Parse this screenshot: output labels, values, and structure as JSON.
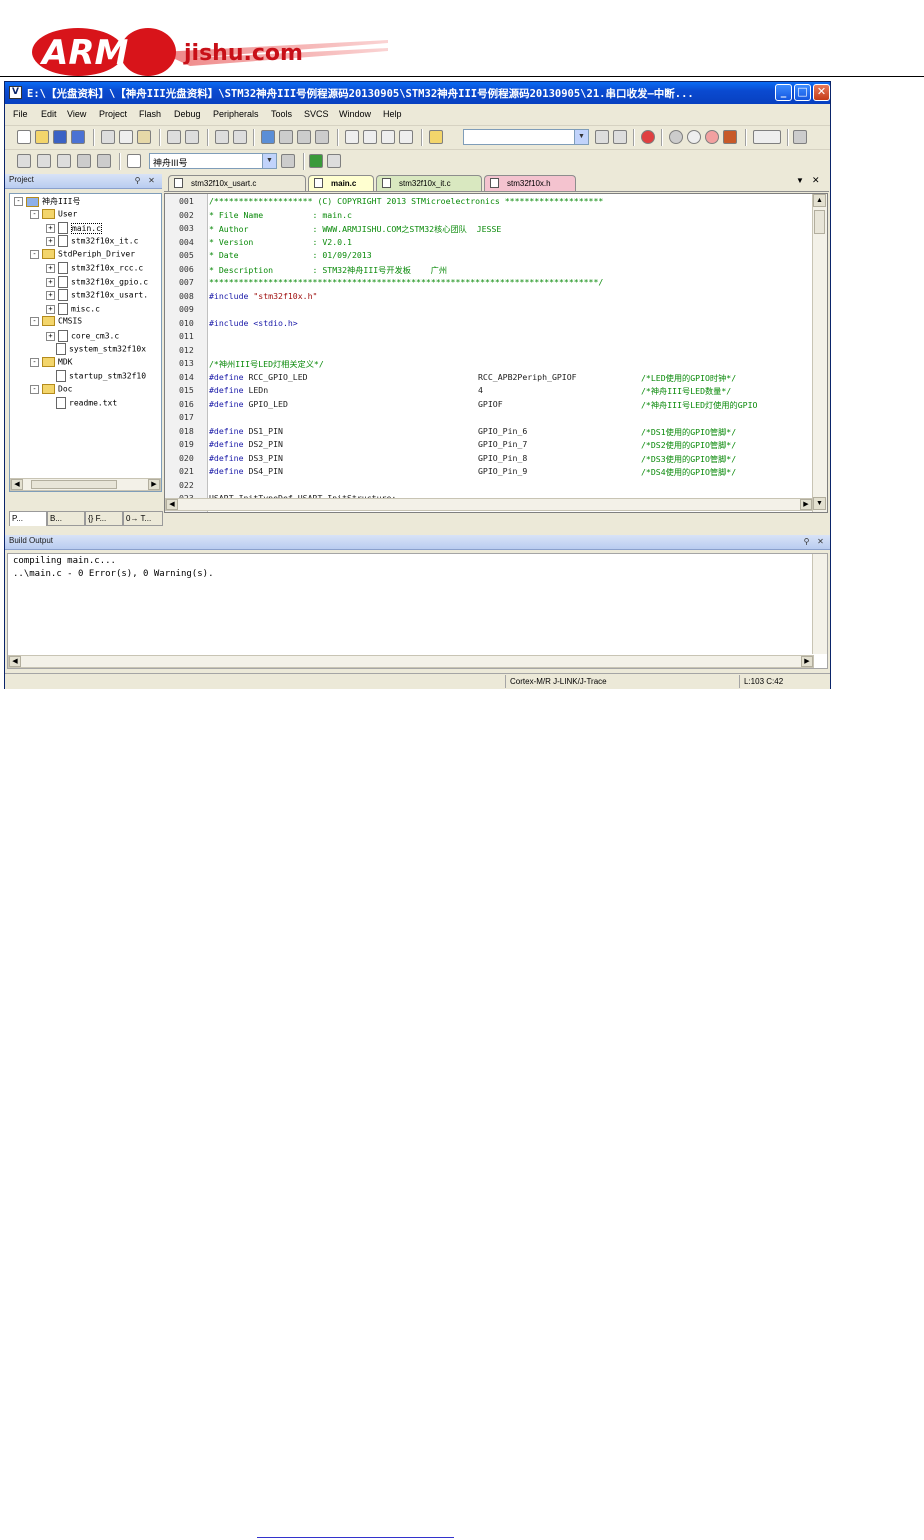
{
  "logo": {
    "text_arm": "ARM",
    "text_domain": "jishu.com"
  },
  "window": {
    "title": "E:\\【光盘资料】\\【神舟III光盘资料】\\STM32神舟III号例程源码20130905\\STM32神舟III号例程源码20130905\\21.串口收发—中断...",
    "buttons": {
      "minimize": "_",
      "maximize": "□",
      "close": "✕"
    }
  },
  "menu": [
    "File",
    "Edit",
    "View",
    "Project",
    "Flash",
    "Debug",
    "Peripherals",
    "Tools",
    "SVCS",
    "Window",
    "Help"
  ],
  "toolbar2": {
    "target_select": "神舟III号"
  },
  "project_panel": {
    "title": "Project",
    "tree": [
      {
        "label": "神舟III号",
        "type": "root",
        "expander": "-"
      },
      {
        "label": "User",
        "type": "folder",
        "expander": "-"
      },
      {
        "label": "main.c",
        "type": "file",
        "expander": "+",
        "selected": true
      },
      {
        "label": "stm32f10x_it.c",
        "type": "file",
        "expander": "+"
      },
      {
        "label": "StdPeriph_Driver",
        "type": "folder",
        "expander": "-"
      },
      {
        "label": "stm32f10x_rcc.c",
        "type": "file",
        "expander": "+"
      },
      {
        "label": "stm32f10x_gpio.c",
        "type": "file",
        "expander": "+"
      },
      {
        "label": "stm32f10x_usart.",
        "type": "file",
        "expander": "+"
      },
      {
        "label": "misc.c",
        "type": "file",
        "expander": "+"
      },
      {
        "label": "CMSIS",
        "type": "folder",
        "expander": "-"
      },
      {
        "label": "core_cm3.c",
        "type": "file",
        "expander": "+"
      },
      {
        "label": "system_stm32f10x",
        "type": "file",
        "expander": ""
      },
      {
        "label": "MDK",
        "type": "folder",
        "expander": "-"
      },
      {
        "label": "startup_stm32f10",
        "type": "file",
        "expander": ""
      },
      {
        "label": "Doc",
        "type": "folder",
        "expander": "-"
      },
      {
        "label": "readme.txt",
        "type": "file",
        "expander": ""
      }
    ],
    "tabs": [
      "P...",
      "B...",
      "{} F...",
      "0→ T..."
    ]
  },
  "editor": {
    "tabs": [
      {
        "label": "stm32f10x_usart.c",
        "color": "#ece9d8"
      },
      {
        "label": "main.c",
        "color": "#ffffd0",
        "active": true
      },
      {
        "label": "stm32f10x_it.c",
        "color": "#d9e8c0"
      },
      {
        "label": "stm32f10x.h",
        "color": "#f4c3cf"
      }
    ],
    "lines": [
      {
        "n": "001",
        "cls": "c-comment",
        "t": "/******************** (C) COPYRIGHT 2013 STMicroelectronics ********************"
      },
      {
        "n": "002",
        "cls": "c-comment",
        "t": "* File Name          : main.c"
      },
      {
        "n": "003",
        "cls": "c-comment",
        "t": "* Author             : WWW.ARMJISHU.COM之STM32核心团队  JESSE"
      },
      {
        "n": "004",
        "cls": "c-comment",
        "t": "* Version            : V2.0.1"
      },
      {
        "n": "005",
        "cls": "c-comment",
        "t": "* Date               : 01/09/2013"
      },
      {
        "n": "006",
        "cls": "c-comment",
        "t": "* Description        : STM32神舟III号开发板    广州"
      },
      {
        "n": "007",
        "cls": "c-comment",
        "t": "*******************************************************************************/"
      },
      {
        "n": "008",
        "cls": "c-pre",
        "t": "#include ",
        "s": "\"stm32f10x.h\""
      },
      {
        "n": "009",
        "cls": "c-plain",
        "t": ""
      },
      {
        "n": "010",
        "cls": "c-pre",
        "t": "#include <stdio.h>"
      },
      {
        "n": "011",
        "cls": "c-plain",
        "t": ""
      },
      {
        "n": "012",
        "cls": "c-plain",
        "t": ""
      },
      {
        "n": "013",
        "cls": "c-comment",
        "t": "/*神州III号LED灯相关定义*/"
      },
      {
        "n": "014",
        "cls": "c-pre",
        "t": "#define ",
        "p": "RCC_GPIO_LED",
        "c2": "RCC_APB2Periph_GPIOF",
        "c3": "/*LED使用的GPIO时钟*/"
      },
      {
        "n": "015",
        "cls": "c-pre",
        "t": "#define ",
        "p": "LEDn",
        "c2": "4",
        "c3": "/*神舟III号LED数量*/"
      },
      {
        "n": "016",
        "cls": "c-pre",
        "t": "#define ",
        "p": "GPIO_LED",
        "c2": "GPIOF",
        "c3": "/*神舟III号LED灯使用的GPIO"
      },
      {
        "n": "017",
        "cls": "c-plain",
        "t": ""
      },
      {
        "n": "018",
        "cls": "c-pre",
        "t": "#define ",
        "p": "DS1_PIN",
        "c2": "GPIO_Pin_6",
        "c3": "/*DS1使用的GPIO管脚*/"
      },
      {
        "n": "019",
        "cls": "c-pre",
        "t": "#define ",
        "p": "DS2_PIN",
        "c2": "GPIO_Pin_7",
        "c3": "/*DS2使用的GPIO管脚*/"
      },
      {
        "n": "020",
        "cls": "c-pre",
        "t": "#define ",
        "p": "DS3_PIN",
        "c2": "GPIO_Pin_8",
        "c3": "/*DS3使用的GPIO管脚*/"
      },
      {
        "n": "021",
        "cls": "c-pre",
        "t": "#define ",
        "p": "DS4_PIN",
        "c2": "GPIO_Pin_9",
        "c3": "/*DS4使用的GPIO管脚*/"
      },
      {
        "n": "022",
        "cls": "c-plain",
        "t": ""
      },
      {
        "n": "023",
        "cls": "c-plain",
        "t": "USART_InitTypeDef USART_InitStructure;"
      }
    ]
  },
  "build_output": {
    "title": "Build Output",
    "lines": [
      "compiling main.c...",
      "..\\main.c - 0 Error(s), 0 Warning(s)."
    ]
  },
  "status": {
    "debugger": "Cortex-M/R J-LINK/J-Trace",
    "position": "L:103 C:42"
  }
}
